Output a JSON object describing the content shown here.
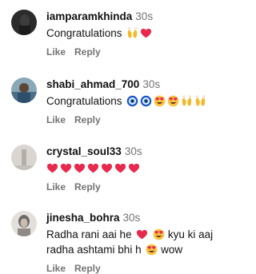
{
  "comments": [
    {
      "username": "iamparamkhinda",
      "time": "30s",
      "text": "Congratulations",
      "emoji": [
        "raising-hands",
        "heart"
      ],
      "like": "Like",
      "reply": "Reply"
    },
    {
      "username": "shabi_ahmad_700",
      "time": "30s",
      "text": "Congratulations",
      "emoji": [
        "nazar-amulet",
        "nazar-amulet",
        "heart-eyes",
        "heart-eyes",
        "raising-hands",
        "raising-hands"
      ],
      "like": "Like",
      "reply": "Reply"
    },
    {
      "username": "crystal_soul33",
      "time": "30s",
      "text": "",
      "emoji": [
        "heart",
        "heart",
        "heart",
        "heart",
        "heart",
        "heart",
        "heart"
      ],
      "like": "Like",
      "reply": "Reply"
    },
    {
      "username": "jinesha_bohra",
      "time": "30s",
      "text_line1_a": "Radha rani aai he",
      "text_line1_b": "kyu ki aaj",
      "text_line2_a": "radha ashtami bhi h",
      "text_line2_b": "wow",
      "like": "Like",
      "reply": "Reply"
    }
  ],
  "colors": {
    "username": "#111111",
    "secondary": "#737373",
    "heart": "#e8294e"
  }
}
